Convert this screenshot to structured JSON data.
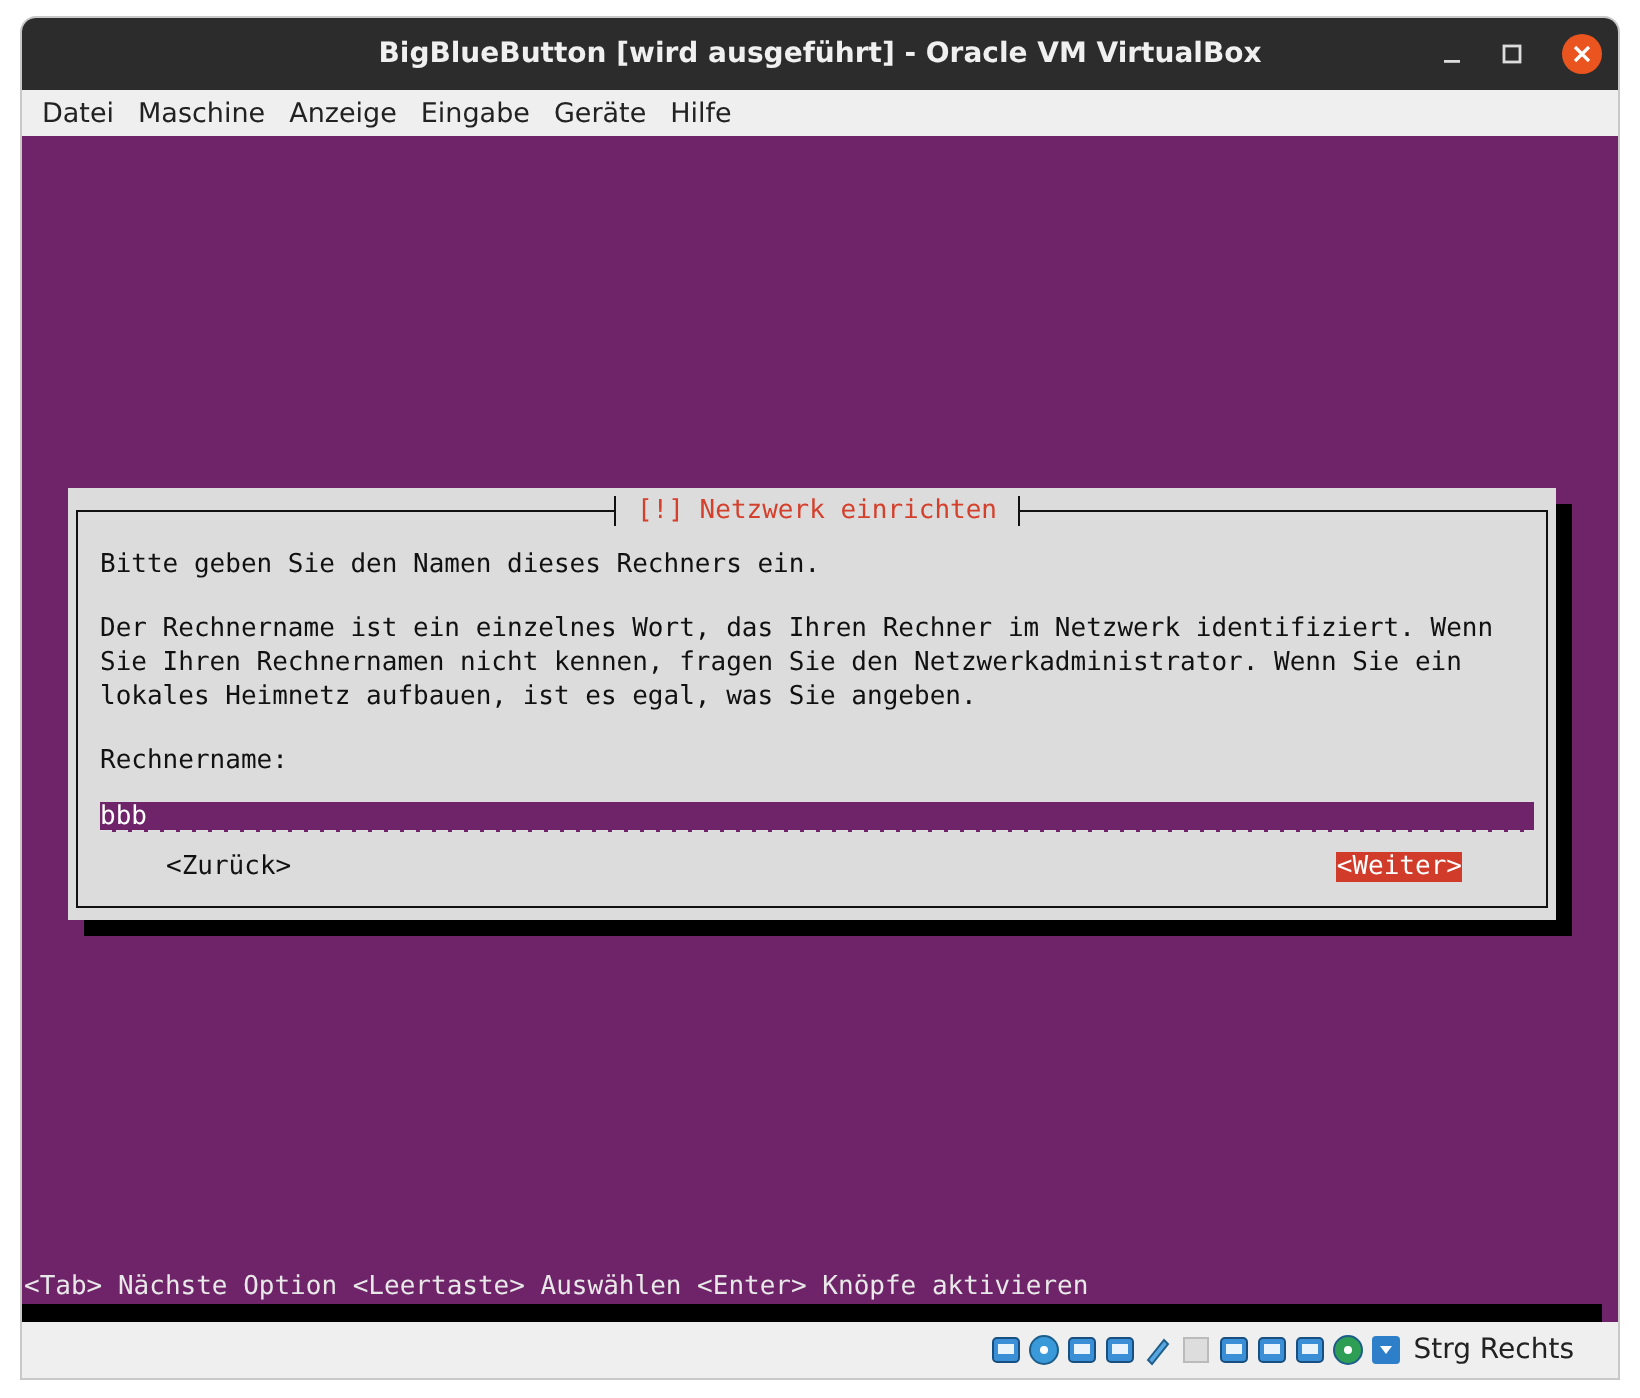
{
  "window": {
    "title": "BigBlueButton [wird ausgeführt] - Oracle VM VirtualBox"
  },
  "menu": [
    "Datei",
    "Maschine",
    "Anzeige",
    "Eingabe",
    "Geräte",
    "Hilfe"
  ],
  "dialog": {
    "title": "[!] Netzwerk einrichten",
    "paragraphs": [
      "Bitte geben Sie den Namen dieses Rechners ein.",
      "Der Rechnername ist ein einzelnes Wort, das Ihren Rechner im Netzwerk identifiziert. Wenn Sie Ihren Rechnernamen nicht kennen, fragen Sie den Netzwerkadministrator. Wenn Sie ein lokales Heimnetz aufbauen, ist es egal, was Sie angeben."
    ],
    "field_label": "Rechnername:",
    "field_value": "bbb",
    "buttons": [
      {
        "label": "<Zurück>",
        "selected": false
      },
      {
        "label": "<Weiter>",
        "selected": true
      }
    ]
  },
  "help_line": "<Tab> Nächste Option <Leertaste> Auswählen <Enter> Knöpfe aktivieren",
  "status_bar": {
    "host_key": "Strg Rechts"
  }
}
